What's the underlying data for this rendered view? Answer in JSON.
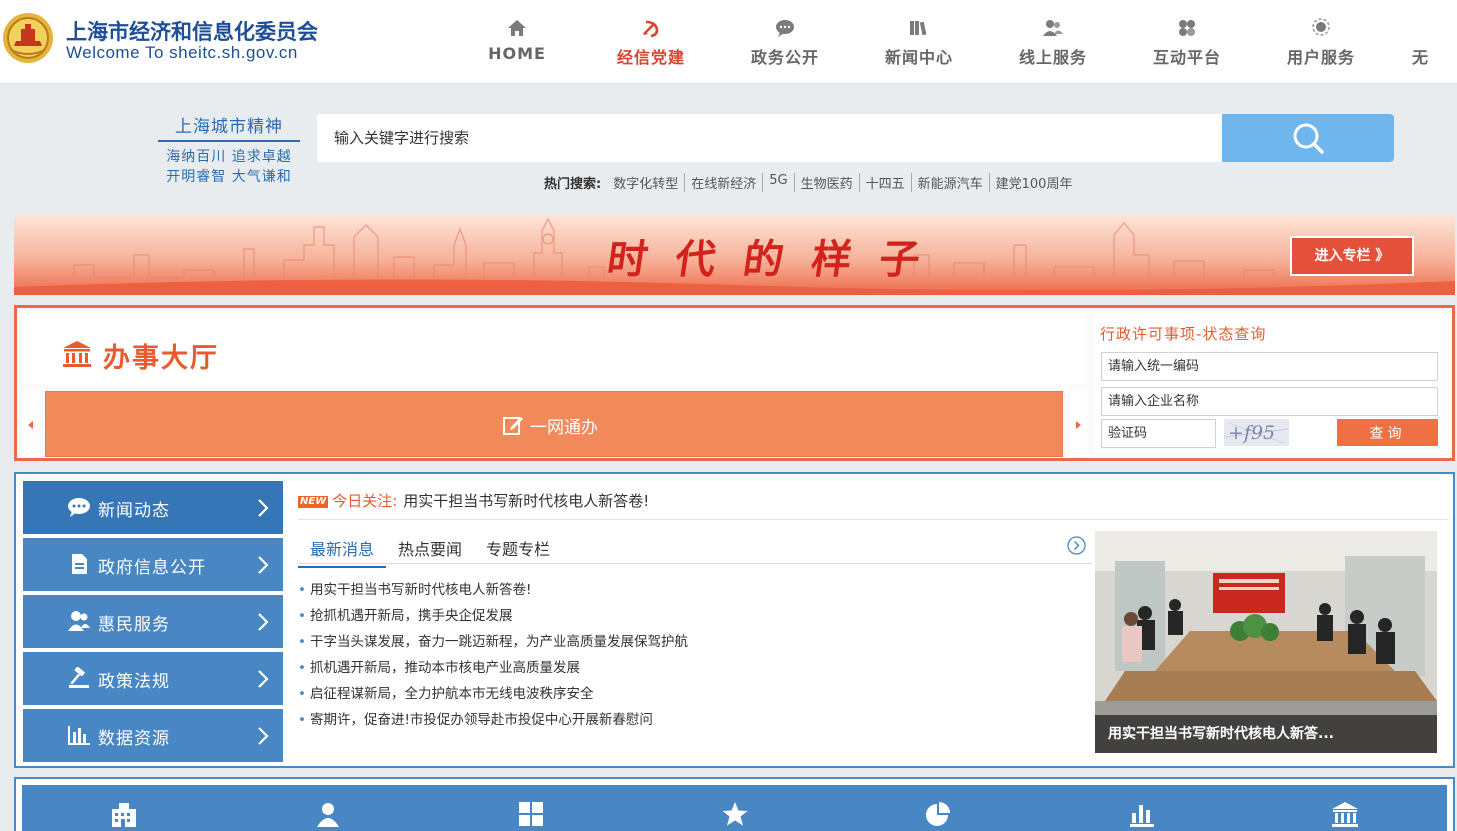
{
  "header": {
    "title_cn": "上海市经济和信息化委员会",
    "title_en": "Welcome To sheitc.sh.gov.cn",
    "nav": [
      {
        "label": "HOME",
        "icon": "home-icon",
        "active": false
      },
      {
        "label": "经信党建",
        "icon": "party-emblem-icon",
        "active": true
      },
      {
        "label": "政务公开",
        "icon": "chat-bubble-icon",
        "active": false
      },
      {
        "label": "新闻中心",
        "icon": "books-icon",
        "active": false
      },
      {
        "label": "线上服务",
        "icon": "users-icon",
        "active": false
      },
      {
        "label": "互动平台",
        "icon": "interact-icon",
        "active": false
      },
      {
        "label": "用户服务",
        "icon": "user-service-icon",
        "active": false
      },
      {
        "label": "无",
        "icon": "",
        "active": false
      }
    ]
  },
  "slogan": {
    "title": "上海城市精神",
    "line1": "海纳百川 追求卓越",
    "line2": "开明睿智 大气谦和"
  },
  "search": {
    "placeholder": "输入关键字进行搜索",
    "hot_label": "热门搜索:",
    "hot_items": [
      "数字化转型",
      "在线新经济",
      "5G",
      "生物医药",
      "十四五",
      "新能源汽车",
      "建党100周年"
    ]
  },
  "banner": {
    "title": "时代的样子",
    "button": "进入专栏 》"
  },
  "hall": {
    "title": "办事大厅",
    "main_label": "一网通办",
    "query_title": "行政许可事项-状态查询",
    "code_placeholder": "请输入统一编码",
    "name_placeholder": "请输入企业名称",
    "captcha_placeholder": "验证码",
    "captcha_text": "+f95",
    "query_button": "查询"
  },
  "side_menu": [
    {
      "label": "新闻动态",
      "icon": "chat-icon"
    },
    {
      "label": "政府信息公开",
      "icon": "document-icon"
    },
    {
      "label": "惠民服务",
      "icon": "people-icon"
    },
    {
      "label": "政策法规",
      "icon": "gavel-icon"
    },
    {
      "label": "数据资源",
      "icon": "bar-chart-icon"
    }
  ],
  "news": {
    "new_tag": "NEW",
    "today_label": "今日关注:",
    "today_text": "用实干担当书写新时代核电人新答卷!",
    "tabs": [
      "最新消息",
      "热点要闻",
      "专题专栏"
    ],
    "items": [
      "用实干担当书写新时代核电人新答卷!",
      "抢抓机遇开新局，携手央企促发展",
      "干字当头谋发展，奋力一跳迈新程，为产业高质量发展保驾护航",
      "抓机遇开新局，推动本市核电产业高质量发展",
      "启征程谋新局，全力护航本市无线电波秩序安全",
      "寄期许，促奋进!市投促办领导赴市投促中心开展新春慰问"
    ],
    "photo_caption": "用实干担当书写新时代核电人新答..."
  },
  "bottom_icons": [
    "building-icon",
    "person-icon",
    "grid-icon",
    "star-icon",
    "pie-chart-icon",
    "bar-chart-icon",
    "bank-icon"
  ],
  "colors": {
    "primary_blue": "#4887c4",
    "accent_orange": "#ea5a2e",
    "active_nav": "#d9432f"
  }
}
